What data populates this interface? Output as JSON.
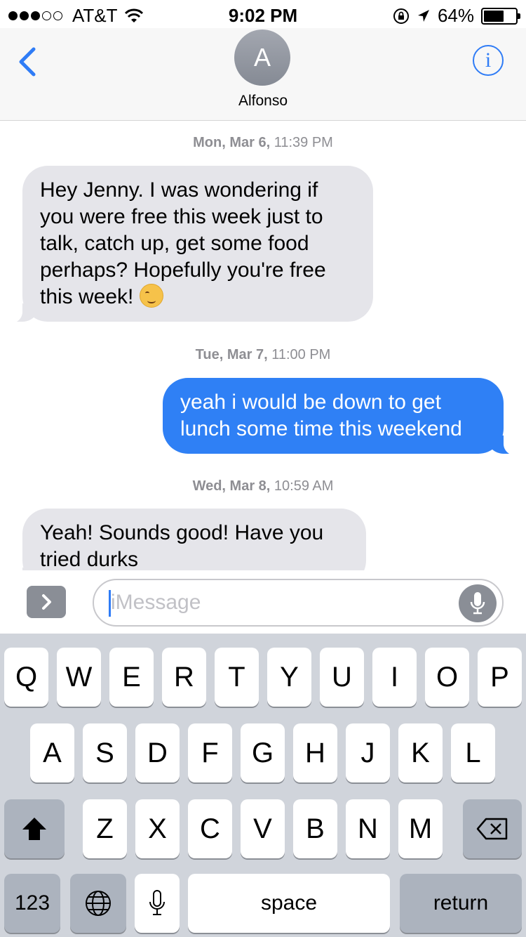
{
  "status_bar": {
    "signal_bars_filled": 3,
    "signal_bars_total": 5,
    "carrier": "AT&T",
    "time": "9:02 PM",
    "battery": "64%",
    "battery_level": 0.64
  },
  "header": {
    "avatar_initial": "A",
    "contact_name": "Alfonso",
    "back_icon": "chevron-left-icon",
    "info_icon": "info-icon",
    "accent_color": "#2f7cf6"
  },
  "messages": [
    {
      "type": "timestamp",
      "day": "Mon, Mar 6,",
      "time": "11:39 PM"
    },
    {
      "type": "incoming",
      "lines": [
        "Hey Jenny. I was wondering if",
        "you were free this week just to",
        "talk, catch up, get some food",
        "perhaps? Hopefully you're free",
        "this week!"
      ],
      "emoji": "smiling-face-emoji"
    },
    {
      "type": "timestamp",
      "day": "Tue, Mar 7,",
      "time": "11:00 PM"
    },
    {
      "type": "outgoing",
      "lines": [
        "yeah i would be down to get",
        "lunch some time this weekend"
      ]
    },
    {
      "type": "timestamp",
      "day": "Wed, Mar 8,",
      "time": "10:59 AM"
    },
    {
      "type": "incoming",
      "lines": [
        "Yeah! Sounds good! Have you",
        "tried durks"
      ]
    }
  ],
  "compose": {
    "placeholder": "iMessage",
    "apps_icon": "chevron-right-icon",
    "dictate_icon": "microphone-icon"
  },
  "keyboard": {
    "row1": [
      "Q",
      "W",
      "E",
      "R",
      "T",
      "Y",
      "U",
      "I",
      "O",
      "P"
    ],
    "row2": [
      "A",
      "S",
      "D",
      "F",
      "G",
      "H",
      "J",
      "K",
      "L"
    ],
    "row3": [
      "Z",
      "X",
      "C",
      "V",
      "B",
      "N",
      "M"
    ],
    "numbers_label": "123",
    "space_label": "space",
    "return_label": "return",
    "shift_icon": "shift-icon",
    "delete_icon": "delete-icon",
    "globe_icon": "globe-icon",
    "mic_icon": "microphone-icon"
  },
  "colors": {
    "incoming_bubble": "#e5e5ea",
    "outgoing_bubble": "#2f80f5",
    "keyboard_bg": "#d0d4db"
  }
}
